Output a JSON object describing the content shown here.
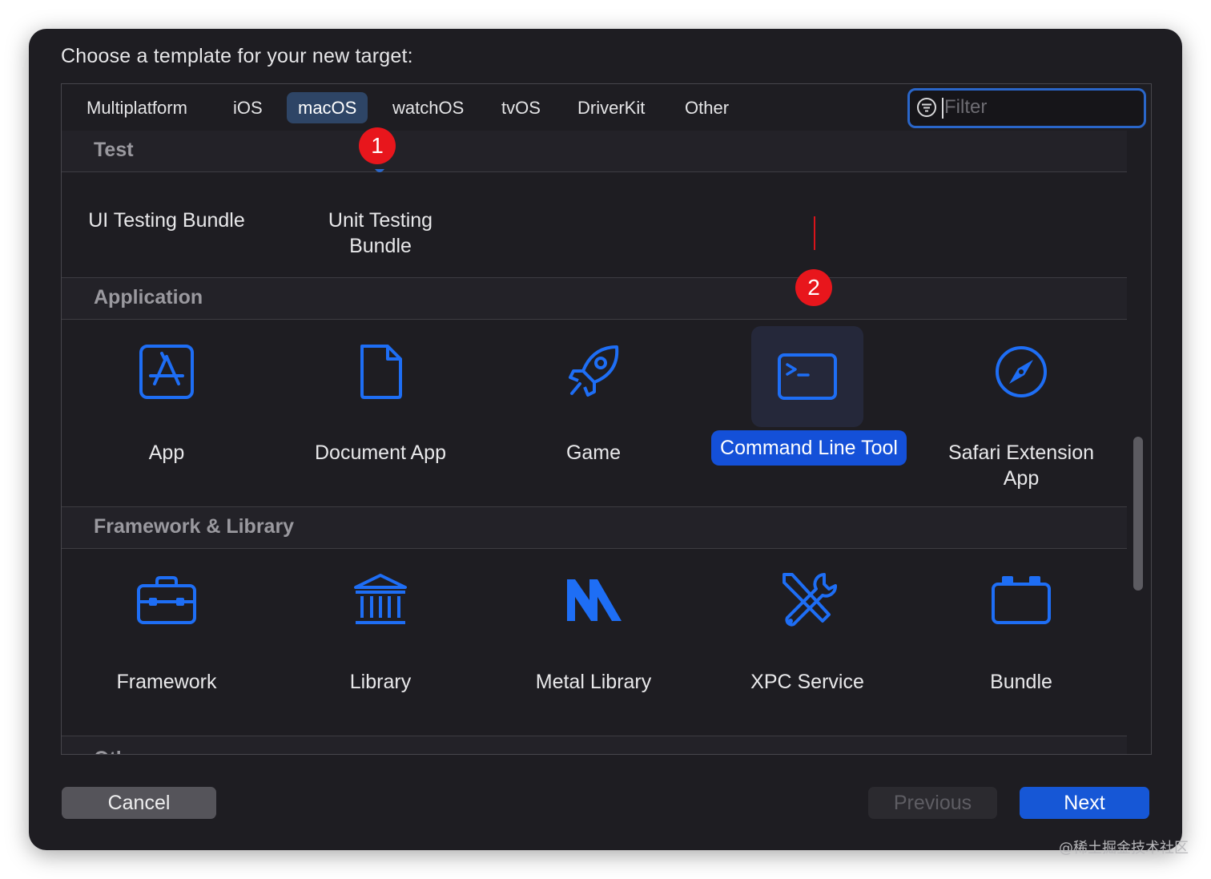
{
  "dialog": {
    "prompt": "Choose a template for your new target:"
  },
  "tabs": [
    {
      "label": "Multiplatform"
    },
    {
      "label": "iOS"
    },
    {
      "label": "macOS",
      "selected": true
    },
    {
      "label": "watchOS"
    },
    {
      "label": "tvOS"
    },
    {
      "label": "DriverKit"
    },
    {
      "label": "Other"
    }
  ],
  "filter": {
    "placeholder": "Filter",
    "value": ""
  },
  "sections": {
    "test": {
      "title": "Test",
      "items": [
        {
          "label": "UI Testing Bundle"
        },
        {
          "label": "Unit Testing Bundle"
        }
      ]
    },
    "application": {
      "title": "Application",
      "items": [
        {
          "label": "App",
          "icon": "app-store-icon"
        },
        {
          "label": "Document App",
          "icon": "document-icon"
        },
        {
          "label": "Game",
          "icon": "rocket-icon"
        },
        {
          "label": "Command Line Tool",
          "icon": "terminal-icon",
          "selected": true
        },
        {
          "label": "Safari Extension App",
          "icon": "compass-icon"
        }
      ]
    },
    "framework": {
      "title": "Framework & Library",
      "items": [
        {
          "label": "Framework",
          "icon": "toolbox-icon"
        },
        {
          "label": "Library",
          "icon": "library-icon"
        },
        {
          "label": "Metal Library",
          "icon": "metal-icon"
        },
        {
          "label": "XPC Service",
          "icon": "tools-icon"
        },
        {
          "label": "Bundle",
          "icon": "bundle-icon"
        }
      ]
    },
    "other": {
      "title": "Other"
    }
  },
  "markers": {
    "first": "1",
    "second": "2"
  },
  "buttons": {
    "cancel": "Cancel",
    "previous": "Previous",
    "next": "Next"
  },
  "watermark": "@稀土掘金技术社区",
  "colors": {
    "accent": "#1657d6",
    "icon_blue": "#1e6ef5",
    "marker_red": "#e8161c",
    "dialog_bg": "#1e1d22"
  }
}
